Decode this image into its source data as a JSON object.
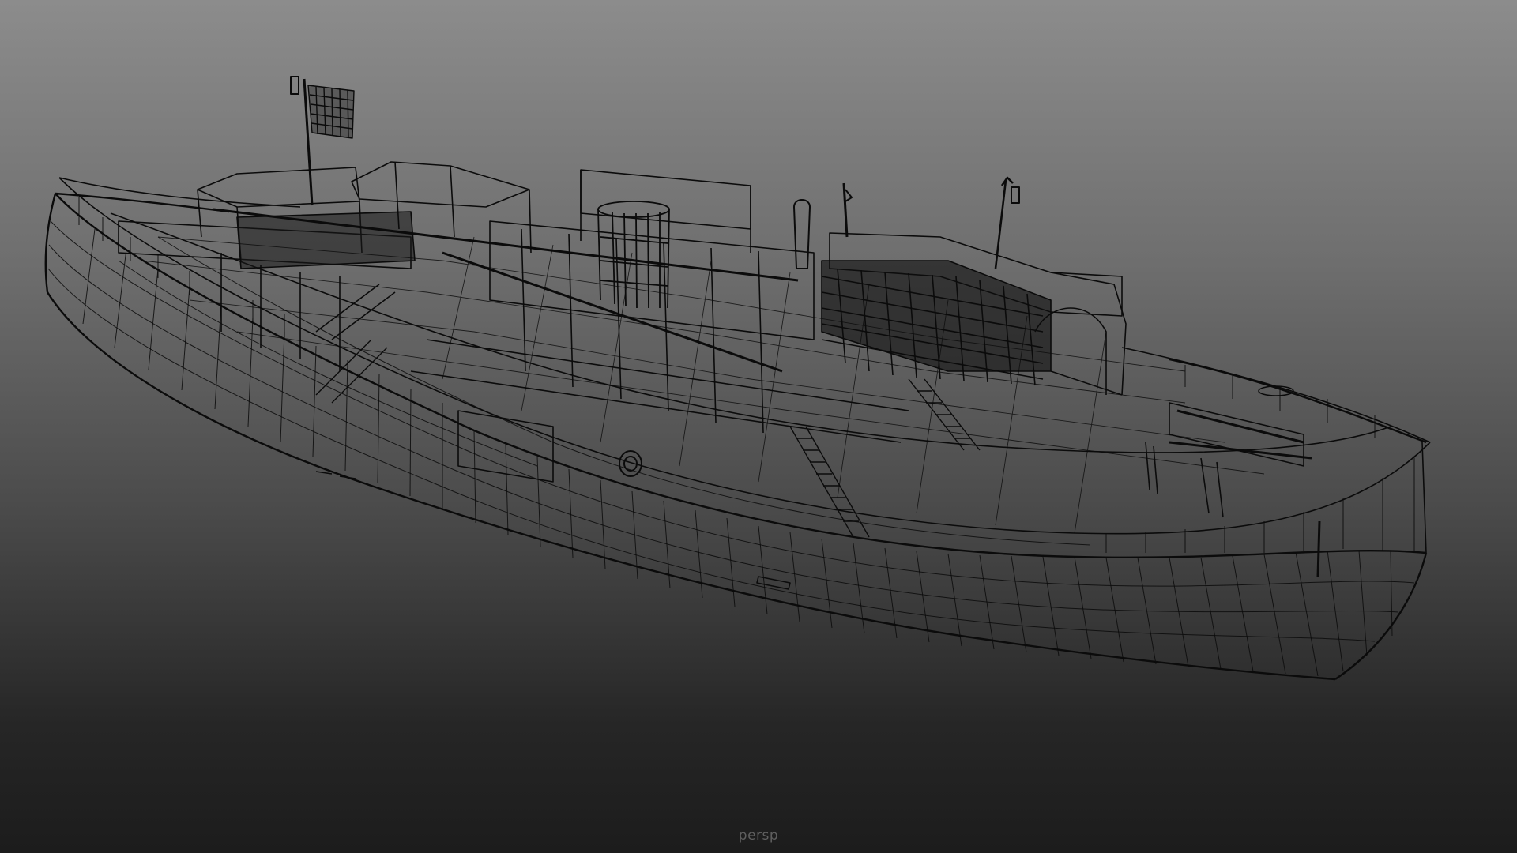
{
  "viewport": {
    "camera_label": "persp",
    "display_mode": "wireframe",
    "background_gradient": [
      "#8c8c8c",
      "#1c1c1c"
    ],
    "wire_color": "#0a0a0a"
  },
  "model": {
    "object": "ship"
  }
}
